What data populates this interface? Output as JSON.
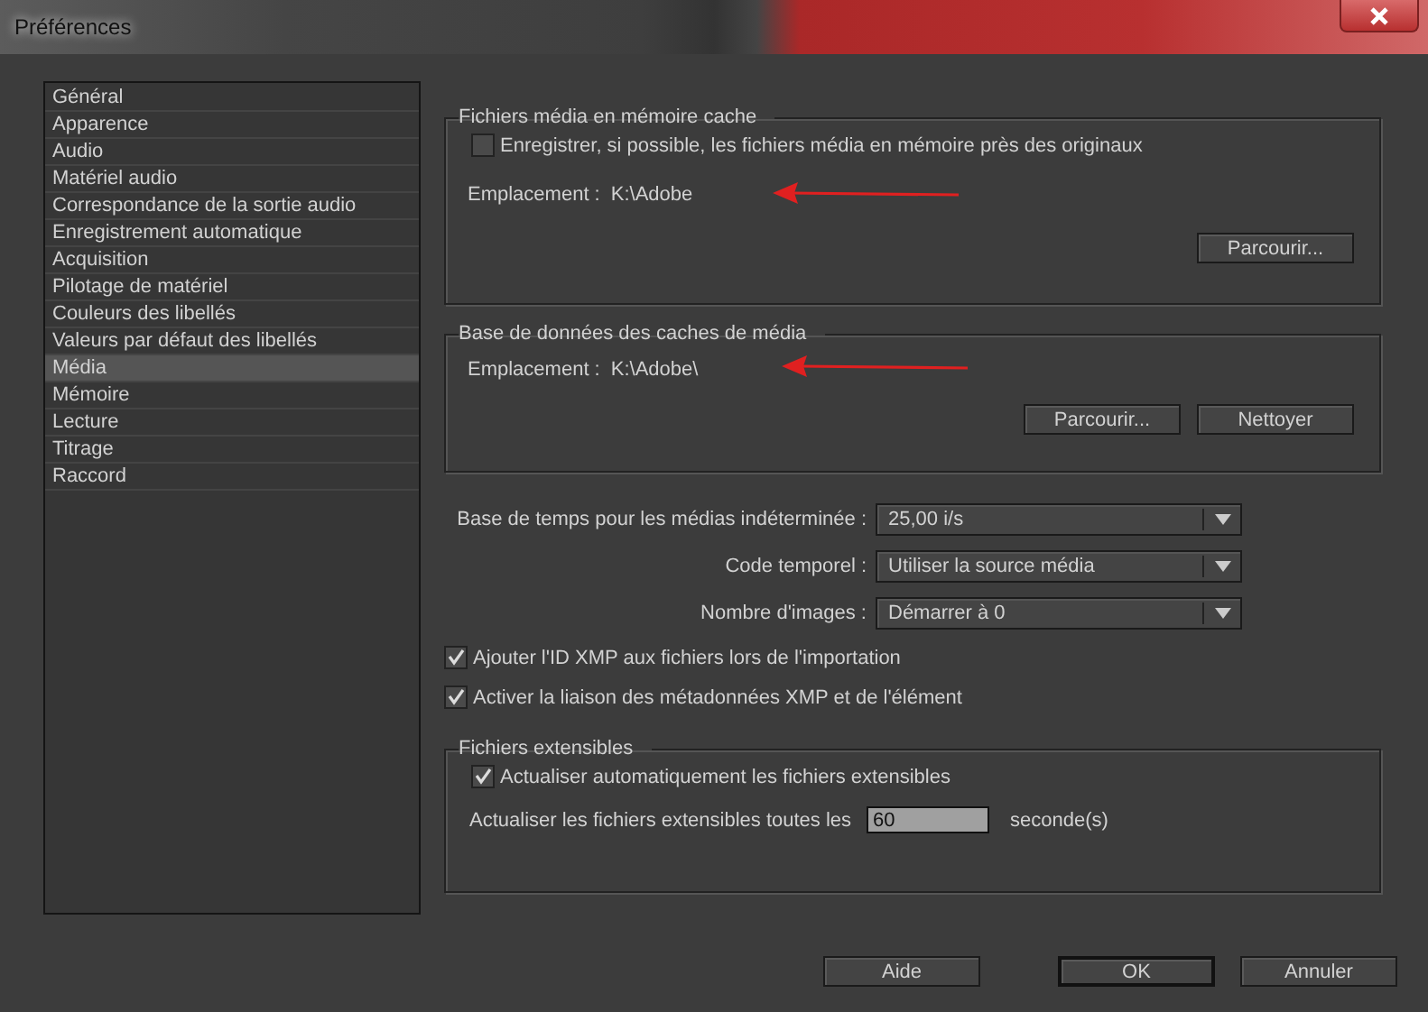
{
  "window": {
    "title": "Préférences"
  },
  "sidebar": {
    "items": [
      {
        "label": "Général",
        "selected": false
      },
      {
        "label": "Apparence",
        "selected": false
      },
      {
        "label": "Audio",
        "selected": false
      },
      {
        "label": "Matériel audio",
        "selected": false
      },
      {
        "label": "Correspondance de la sortie audio",
        "selected": false
      },
      {
        "label": "Enregistrement automatique",
        "selected": false
      },
      {
        "label": "Acquisition",
        "selected": false
      },
      {
        "label": "Pilotage de matériel",
        "selected": false
      },
      {
        "label": "Couleurs des libellés",
        "selected": false
      },
      {
        "label": "Valeurs par défaut des libellés",
        "selected": false
      },
      {
        "label": "Média",
        "selected": true
      },
      {
        "label": "Mémoire",
        "selected": false
      },
      {
        "label": "Lecture",
        "selected": false
      },
      {
        "label": "Titrage",
        "selected": false
      },
      {
        "label": "Raccord",
        "selected": false
      }
    ]
  },
  "media_cache_files": {
    "title": "Fichiers média en mémoire cache",
    "checkbox": {
      "label": "Enregistrer, si possible, les fichiers média en mémoire près des originaux",
      "checked": false
    },
    "location_label": "Emplacement :",
    "location": "K:\\Adobe",
    "buttons": [
      "Parcourir..."
    ]
  },
  "media_cache_database": {
    "title": "Base de données des caches de média",
    "location_label": "Emplacement :",
    "location": "K:\\Adobe\\",
    "buttons": [
      "Parcourir...",
      "Nettoyer"
    ]
  },
  "dropdowns": [
    {
      "label": "Base de temps pour les médias indéterminée :",
      "value": "25,00 i/s"
    },
    {
      "label": "Code temporel :",
      "value": "Utiliser la source média"
    },
    {
      "label": "Nombre d'images :",
      "value": "Démarrer à 0"
    }
  ],
  "checkboxes": [
    {
      "label": "Ajouter l'ID XMP aux fichiers lors de l'importation",
      "checked": true
    },
    {
      "label": "Activer la liaison des métadonnées XMP et de l'élément",
      "checked": true
    }
  ],
  "growing_files": {
    "title": "Fichiers extensibles",
    "checkbox": {
      "label": "Actualiser automatiquement les fichiers extensibles",
      "checked": true
    },
    "refresh_label": "Actualiser les fichiers extensibles toutes les",
    "refresh_value": "60",
    "refresh_unit": "seconde(s)"
  },
  "footer_buttons": [
    {
      "label": "Aide",
      "default": false
    },
    {
      "label": "OK",
      "default": true
    },
    {
      "label": "Annuler",
      "default": false
    }
  ]
}
